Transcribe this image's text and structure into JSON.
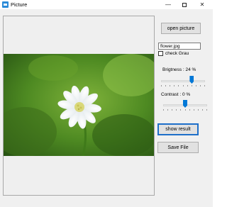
{
  "window": {
    "title": "Picture"
  },
  "controls": {
    "open_label": "open picture",
    "filename_value": "flower.jpg",
    "check_label": "check Grau",
    "brightness_label": "Brigtness : 24 %",
    "brightness_level": 0.7,
    "contrast_label": "Contrast : 0 %",
    "contrast_level": 0.5,
    "show_label": "show result",
    "save_label": "Save File"
  },
  "colors": {
    "accent": "#0078d7",
    "focus": "#1e6fc9"
  }
}
